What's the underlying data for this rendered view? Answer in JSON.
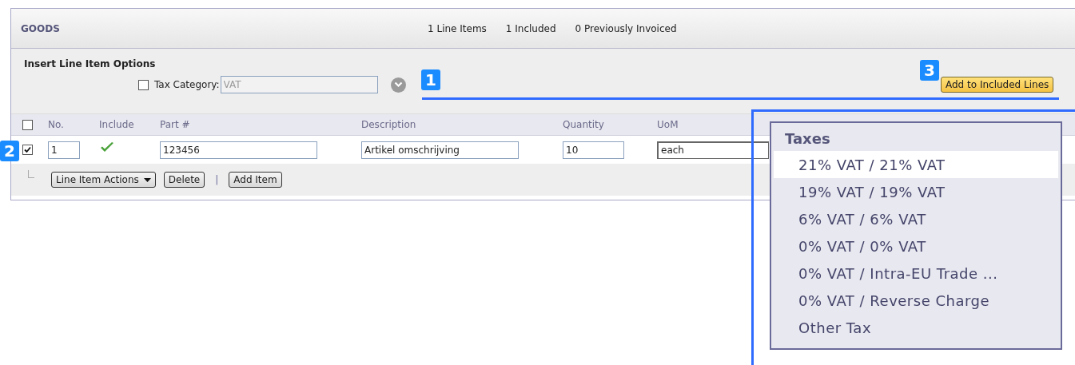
{
  "section": {
    "title": "GOODS",
    "stats": [
      "1 Line Items",
      "1 Included",
      "0 Previously Invoiced"
    ]
  },
  "options": {
    "title": "Insert Line Item Options",
    "tax_category": {
      "checked": false,
      "label": "Tax Category:",
      "value": "VAT"
    },
    "button": "Add to Included Lines"
  },
  "table": {
    "header_checked": false,
    "columns": [
      "No.",
      "Include",
      "Part #",
      "Description",
      "Quantity",
      "UoM"
    ],
    "rows": [
      {
        "checked": true,
        "no": "1",
        "included": true,
        "part": "123456",
        "description": "Artikel omschrijving",
        "quantity": "10",
        "uom": "each"
      }
    ]
  },
  "actions": [
    {
      "kind": "menu",
      "label": "Line Item Actions"
    },
    {
      "kind": "button",
      "label": "Delete"
    },
    {
      "kind": "separator",
      "label": "|"
    },
    {
      "kind": "button",
      "label": "Add Item"
    }
  ],
  "dropdown": {
    "title": "Taxes",
    "items": [
      {
        "label": "21% VAT / 21% VAT",
        "selected": true
      },
      {
        "label": "19% VAT / 19% VAT",
        "selected": false
      },
      {
        "label": "6% VAT / 6% VAT",
        "selected": false
      },
      {
        "label": "0% VAT / 0% VAT",
        "selected": false
      },
      {
        "label": "0% VAT / Intra-EU Trade ...",
        "selected": false
      },
      {
        "label": "0% VAT / Reverse Charge",
        "selected": false
      },
      {
        "label": "Other Tax",
        "selected": false
      }
    ]
  },
  "callouts": [
    "1",
    "2",
    "3"
  ]
}
